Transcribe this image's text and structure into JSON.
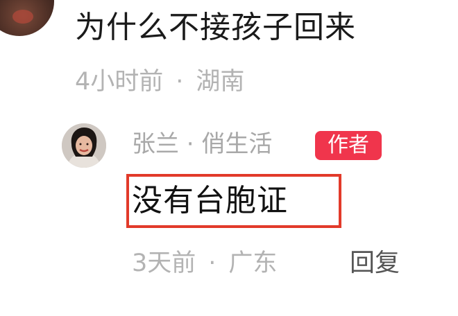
{
  "parent_comment": {
    "text": "为什么不接孩子回来",
    "time": "4小时前",
    "separator": "·",
    "location": "湖南"
  },
  "reply": {
    "author": "张兰 · 俏生活",
    "badge": "作者",
    "text": "没有台胞证",
    "time": "3天前",
    "separator": "·",
    "location": "广东",
    "reply_label": "回复"
  },
  "colors": {
    "badge_bg": "#f0354c",
    "highlight_border": "#e23a2a",
    "meta_text": "#b3b3b3",
    "primary_text": "#1a1a1a"
  },
  "icons": {
    "parent_avatar": "user-avatar-icon",
    "reply_avatar": "author-avatar-icon"
  }
}
